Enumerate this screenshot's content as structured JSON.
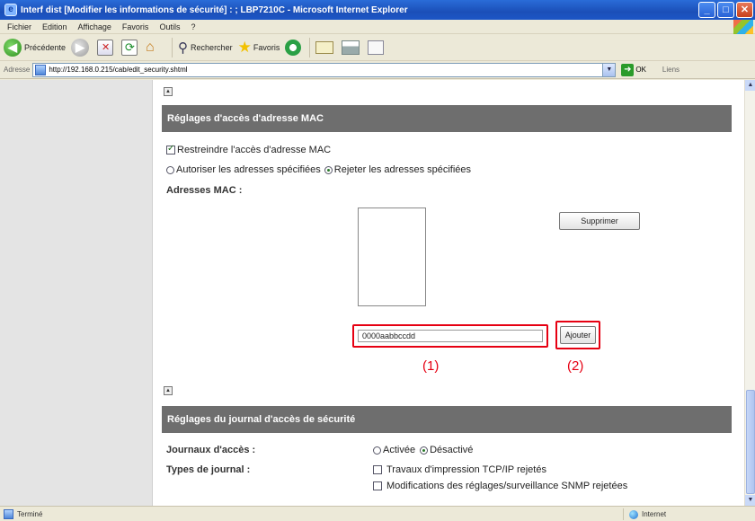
{
  "window": {
    "title": "Interf dist [Modifier les informations de sécurité] : ; LBP7210C - Microsoft Internet Explorer",
    "ie_icon_glyph": "e",
    "controls": [
      "_",
      "□",
      "✕"
    ]
  },
  "menu": [
    "Fichier",
    "Edition",
    "Affichage",
    "Favoris",
    "Outils",
    "?"
  ],
  "toolbar": {
    "back_label": "Précédente",
    "back_glyph": "◀",
    "forward_glyph": "▶",
    "search_label": "Rechercher",
    "favorites_label": "Favoris"
  },
  "address": {
    "label": "Adresse",
    "url": "http://192.168.0.215/cab/edit_security.shtml",
    "go_label": "OK",
    "links_label": "Liens"
  },
  "mac_section": {
    "header": "Réglages d'accès d'adresse MAC",
    "restrict_label": "Restreindre l'accès d'adresse MAC",
    "restrict_checked": true,
    "allow_label": "Autoriser les adresses spécifiées",
    "reject_label": "Rejeter les adresses spécifiées",
    "selected_mode": "reject",
    "mac_label": "Adresses MAC :",
    "delete_button": "Supprimer",
    "mac_input_value": "0000aabbccdd",
    "add_button": "Ajouter",
    "callout_1": "(1)",
    "callout_2": "(2)"
  },
  "journal_section": {
    "header": "Réglages du journal d'accès de sécurité",
    "logs_label": "Journaux d'accès :",
    "on_label": "Activée",
    "off_label": "Désactivé",
    "types_label": "Types de journal :",
    "types": [
      "Travaux d'impression TCP/IP rejetés",
      "Modifications des réglages/surveillance SNMP rejetées"
    ]
  },
  "scroll_glyphs": {
    "to_top": "▲",
    "up": "▲",
    "down": "▼",
    "dropdown": "▼",
    "go": "➜"
  },
  "status": {
    "text": "Terminé",
    "zone": "Internet"
  }
}
